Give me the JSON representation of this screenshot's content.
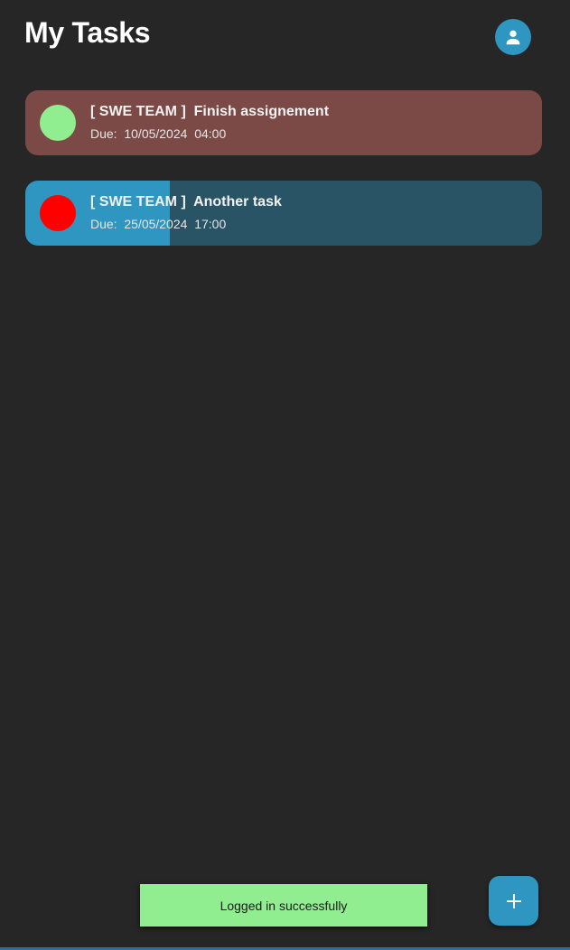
{
  "app": {
    "title": "My Tasks"
  },
  "header": {
    "profile_icon": "person-icon",
    "accent_color": "#2e96c0"
  },
  "tasks": [
    {
      "team": "[ SWE TEAM ]",
      "name": "Finish assignement",
      "title_line": "[ SWE TEAM ]  Finish assignement",
      "due_line": "Due:  10/05/2024  04:00",
      "status_color": "#90ee90",
      "card_color": "#7b4a46",
      "progress_color": "#7b4a46",
      "progress": 0
    },
    {
      "team": "[ SWE TEAM ]",
      "name": "Another task",
      "title_line": "[ SWE TEAM ]  Another task",
      "due_line": "Due:  25/05/2024  17:00",
      "status_color": "#ff0000",
      "card_color": "#285465",
      "progress_color": "#2e96c0",
      "progress": 0.28
    }
  ],
  "fab": {
    "icon": "plus-icon"
  },
  "toast": {
    "message": "Logged in successfully",
    "color": "#90ee90"
  }
}
